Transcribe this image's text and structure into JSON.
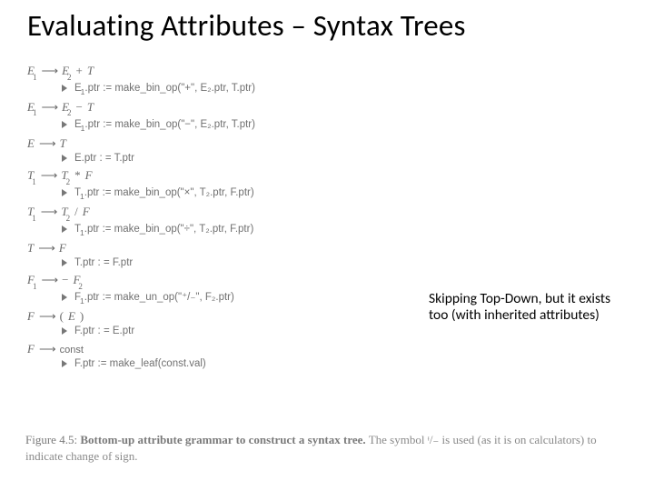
{
  "title": "Evaluating Attributes – Syntax Trees",
  "note": "Skipping Top-Down, but it exists too (with inherited attributes)",
  "caption_lead": "Figure 4.5:",
  "caption_strong": "Bottom-up attribute grammar to construct a syntax tree.",
  "caption_rest": "The symbol ᶧ/₋ is used (as it is on calculators) to indicate change of sign.",
  "rules": [
    {
      "lhs": "E",
      "lhs_sub": "1",
      "rhs": [
        {
          "t": "E",
          "sub": "2"
        },
        {
          "t": "+",
          "op": true
        },
        {
          "t": "T"
        }
      ],
      "sem_lhs": "E",
      "sem_lhs_sub": "1",
      "sem_attr": ".ptr",
      "sem_rhs": "make_bin_op(\"+\", E₂.ptr, T.ptr)"
    },
    {
      "lhs": "E",
      "lhs_sub": "1",
      "rhs": [
        {
          "t": "E",
          "sub": "2"
        },
        {
          "t": "−",
          "op": true
        },
        {
          "t": "T"
        }
      ],
      "sem_lhs": "E",
      "sem_lhs_sub": "1",
      "sem_attr": ".ptr",
      "sem_rhs": "make_bin_op(\"−\", E₂.ptr, T.ptr)"
    },
    {
      "lhs": "E",
      "lhs_sub": "",
      "rhs": [
        {
          "t": "T"
        }
      ],
      "sem_lhs": "E",
      "sem_lhs_sub": "",
      "sem_attr": ".ptr",
      "sem_rhs": "T.ptr",
      "sem_simple": true
    },
    {
      "lhs": "T",
      "lhs_sub": "1",
      "rhs": [
        {
          "t": "T",
          "sub": "2"
        },
        {
          "t": "*",
          "op": true
        },
        {
          "t": "F"
        }
      ],
      "sem_lhs": "T",
      "sem_lhs_sub": "1",
      "sem_attr": ".ptr",
      "sem_rhs": "make_bin_op(\"×\", T₂.ptr, F.ptr)"
    },
    {
      "lhs": "T",
      "lhs_sub": "1",
      "rhs": [
        {
          "t": "T",
          "sub": "2"
        },
        {
          "t": "/",
          "op": true
        },
        {
          "t": "F"
        }
      ],
      "sem_lhs": "T",
      "sem_lhs_sub": "1",
      "sem_attr": ".ptr",
      "sem_rhs": "make_bin_op(\"÷\", T₂.ptr, F.ptr)"
    },
    {
      "lhs": "T",
      "lhs_sub": "",
      "rhs": [
        {
          "t": "F"
        }
      ],
      "sem_lhs": "T",
      "sem_lhs_sub": "",
      "sem_attr": ".ptr",
      "sem_rhs": "F.ptr",
      "sem_simple": true
    },
    {
      "lhs": "F",
      "lhs_sub": "1",
      "rhs": [
        {
          "t": "−",
          "op": true
        },
        {
          "t": "F",
          "sub": "2"
        }
      ],
      "sem_lhs": "F",
      "sem_lhs_sub": "1",
      "sem_attr": ".ptr",
      "sem_rhs": "make_un_op(\"⁺/₋\", F₂.ptr)"
    },
    {
      "lhs": "F",
      "lhs_sub": "",
      "rhs": [
        {
          "t": "(",
          "op": true
        },
        {
          "t": "E"
        },
        {
          "t": ")",
          "op": true
        }
      ],
      "sem_lhs": "F",
      "sem_lhs_sub": "",
      "sem_attr": ".ptr",
      "sem_rhs": "E.ptr",
      "sem_simple": true
    },
    {
      "lhs": "F",
      "lhs_sub": "",
      "rhs": [
        {
          "t": "const",
          "sf": true
        }
      ],
      "sem_lhs": "F",
      "sem_lhs_sub": "",
      "sem_attr": ".ptr",
      "sem_rhs": "make_leaf(const.val)"
    }
  ]
}
